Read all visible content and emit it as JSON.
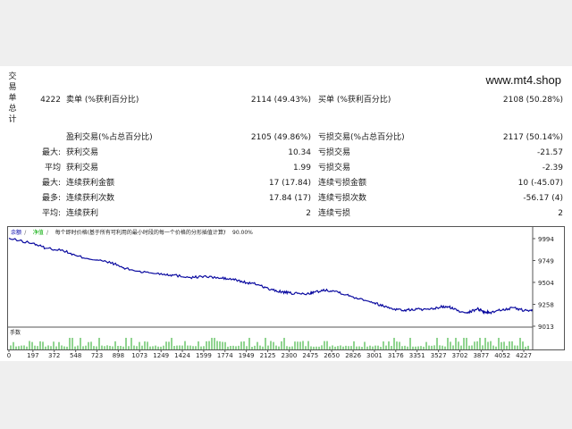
{
  "sidebar": {
    "label_chars": [
      "交",
      "易",
      "单",
      "总",
      "计"
    ]
  },
  "brand": {
    "text": "www.mt4.shop"
  },
  "summary": {
    "total": "4222",
    "sell_label": "卖单 (%获利百分比)",
    "sell_value": "2114 (49.43%)",
    "buy_label": "买单 (%获利百分比)",
    "buy_value": "2108 (50.28%)"
  },
  "rows": [
    {
      "l1": "",
      "l2": "盈利交易(%占总百分比)",
      "v1": "2105 (49.86%)",
      "l3": "亏损交易(%占总百分比)",
      "v2": "2117 (50.14%)"
    },
    {
      "l1": "最大:",
      "l2": "获利交易",
      "v1": "10.34",
      "l3": "亏损交易",
      "v2": "-21.57"
    },
    {
      "l1": "平均",
      "l2": "获利交易",
      "v1": "1.99",
      "l3": "亏损交易",
      "v2": "-2.39"
    },
    {
      "l1": "最大:",
      "l2": "连续获利金额",
      "v1": "17 (17.84)",
      "l3": "连续亏损金额",
      "v2": "10 (-45.07)"
    },
    {
      "l1": "最多:",
      "l2": "连续获利次数",
      "v1": "17.84 (17)",
      "l3": "连续亏损次数",
      "v2": "-56.17 (4)"
    },
    {
      "l1": "平均:",
      "l2": "连续获利",
      "v1": "2",
      "l3": "连续亏损",
      "v2": "2"
    }
  ],
  "chart_data": {
    "type": "line",
    "legend": [
      "余额",
      "/",
      "净值",
      "/",
      "每个即时价格(基于所有可利用的最小时段的每一个价格的分形插值计算)",
      "/",
      "90.00%"
    ],
    "legend_colors": [
      "#0000aa",
      "#666666",
      "#00aa00",
      "#666666",
      "#222222",
      "#666666",
      "#222222"
    ],
    "y_ticks": [
      9994,
      9749,
      9504,
      9258,
      9013
    ],
    "ylim": [
      9013,
      9994
    ],
    "x_ticks": [
      0,
      197,
      372,
      548,
      723,
      898,
      1073,
      1249,
      1424,
      1599,
      1774,
      1949,
      2125,
      2300,
      2475,
      2650,
      2826,
      3001,
      3176,
      3351,
      3527,
      3702,
      3877,
      4052,
      4227
    ],
    "xlim": [
      0,
      4300
    ],
    "volume_label": "手数",
    "series": [
      {
        "values": [
          {
            "x": 0,
            "y": 9994
          },
          {
            "x": 200,
            "y": 9940
          },
          {
            "x": 300,
            "y": 9890
          },
          {
            "x": 450,
            "y": 9860
          },
          {
            "x": 550,
            "y": 9800
          },
          {
            "x": 700,
            "y": 9760
          },
          {
            "x": 850,
            "y": 9720
          },
          {
            "x": 950,
            "y": 9660
          },
          {
            "x": 1100,
            "y": 9620
          },
          {
            "x": 1250,
            "y": 9600
          },
          {
            "x": 1350,
            "y": 9585
          },
          {
            "x": 1500,
            "y": 9560
          },
          {
            "x": 1600,
            "y": 9570
          },
          {
            "x": 1750,
            "y": 9550
          },
          {
            "x": 1850,
            "y": 9535
          },
          {
            "x": 1950,
            "y": 9500
          },
          {
            "x": 2050,
            "y": 9480
          },
          {
            "x": 2150,
            "y": 9420
          },
          {
            "x": 2250,
            "y": 9395
          },
          {
            "x": 2330,
            "y": 9380
          },
          {
            "x": 2450,
            "y": 9375
          },
          {
            "x": 2500,
            "y": 9390
          },
          {
            "x": 2600,
            "y": 9420
          },
          {
            "x": 2700,
            "y": 9400
          },
          {
            "x": 2800,
            "y": 9350
          },
          {
            "x": 2950,
            "y": 9300
          },
          {
            "x": 3050,
            "y": 9250
          },
          {
            "x": 3150,
            "y": 9210
          },
          {
            "x": 3250,
            "y": 9190
          },
          {
            "x": 3350,
            "y": 9205
          },
          {
            "x": 3450,
            "y": 9195
          },
          {
            "x": 3550,
            "y": 9230
          },
          {
            "x": 3620,
            "y": 9225
          },
          {
            "x": 3700,
            "y": 9180
          },
          {
            "x": 3780,
            "y": 9170
          },
          {
            "x": 3850,
            "y": 9210
          },
          {
            "x": 3900,
            "y": 9175
          },
          {
            "x": 3950,
            "y": 9165
          },
          {
            "x": 4050,
            "y": 9200
          },
          {
            "x": 4150,
            "y": 9215
          },
          {
            "x": 4250,
            "y": 9185
          },
          {
            "x": 4350,
            "y": 9195
          }
        ]
      }
    ]
  }
}
